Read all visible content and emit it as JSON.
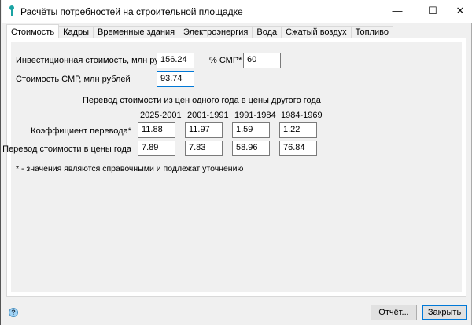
{
  "window": {
    "title": "Расчёты потребностей на строительной площадке",
    "minimize": "—",
    "maximize": "☐",
    "close": "✕"
  },
  "tabs": [
    "Стоимость",
    "Кадры",
    "Временные здания",
    "Электроэнергия",
    "Вода",
    "Сжатый воздух",
    "Топливо"
  ],
  "cost": {
    "invest_label": "Инвестиционная стоимость, млн рублей",
    "invest_value": "156.24",
    "smr_pct_label": "% СМР*",
    "smr_pct_value": "60",
    "smr_label": "Стоимость СМР, млн рублей",
    "smr_value": "93.74",
    "conversion_title": "Перевод стоимости из цен одного года в цены другого года",
    "periods": [
      "2025-2001",
      "2001-1991",
      "1991-1984",
      "1984-1969"
    ],
    "coef_label": "Коэффициент перевода*",
    "coefs": [
      "11.88",
      "11.97",
      "1.59",
      "1.22"
    ],
    "conv_label": "Перевод стоимости в цены года",
    "conv": [
      "7.89",
      "7.83",
      "58.96",
      "76.84"
    ],
    "note": "* - значения являются справочными и подлежат уточнению"
  },
  "buttons": {
    "report": "Отчёт...",
    "close": "Закрыть",
    "help": "?"
  },
  "colors": {
    "accent": "#0078d7"
  }
}
